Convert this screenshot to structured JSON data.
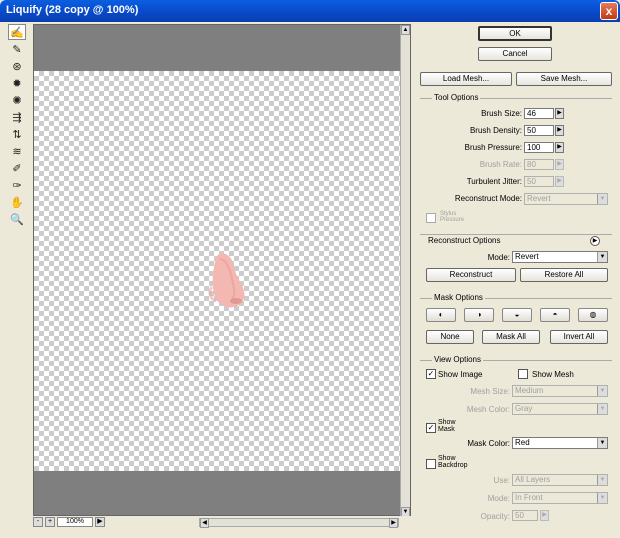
{
  "window": {
    "title": "Liquify (28 copy @ 100%)",
    "close_glyph": "x"
  },
  "tools": [
    {
      "name": "forward-warp-tool-icon",
      "glyph": "✍"
    },
    {
      "name": "reconstruct-tool-icon",
      "glyph": "✎"
    },
    {
      "name": "twirl-clockwise-tool-icon",
      "glyph": "⊛"
    },
    {
      "name": "pucker-tool-icon",
      "glyph": "✹"
    },
    {
      "name": "bloat-tool-icon",
      "glyph": "✺"
    },
    {
      "name": "push-left-tool-icon",
      "glyph": "⇶"
    },
    {
      "name": "mirror-tool-icon",
      "glyph": "⇅"
    },
    {
      "name": "turbulence-tool-icon",
      "glyph": "≋"
    },
    {
      "name": "freeze-mask-tool-icon",
      "glyph": "✐"
    },
    {
      "name": "thaw-mask-tool-icon",
      "glyph": "✑"
    },
    {
      "name": "hand-tool-icon",
      "glyph": "✋"
    },
    {
      "name": "zoom-tool-icon",
      "glyph": "🔍"
    }
  ],
  "statusbar": {
    "zoom": "100%",
    "minus": "-",
    "plus": "+"
  },
  "buttons": {
    "ok": "OK",
    "cancel": "Cancel",
    "load_mesh": "Load Mesh...",
    "save_mesh": "Save Mesh..."
  },
  "tool_options": {
    "title": "Tool Options",
    "brush_size_label": "Brush Size:",
    "brush_size": "46",
    "brush_density_label": "Brush Density:",
    "brush_density": "50",
    "brush_pressure_label": "Brush Pressure:",
    "brush_pressure": "100",
    "brush_rate_label": "Brush Rate:",
    "brush_rate": "80",
    "turbulent_jitter_label": "Turbulent Jitter:",
    "turbulent_jitter": "50",
    "reconstruct_mode_label": "Reconstruct Mode:",
    "reconstruct_mode": "Revert",
    "stylus_pressure_label": "Stylus Pressure"
  },
  "reconstruct_options": {
    "title": "Reconstruct Options",
    "mode_label": "Mode:",
    "mode": "Revert",
    "reconstruct_button": "Reconstruct",
    "restore_all_button": "Restore All"
  },
  "mask_options": {
    "title": "Mask Options",
    "none_button": "None",
    "mask_all_button": "Mask All",
    "invert_all_button": "Invert All"
  },
  "view_options": {
    "title": "View Options",
    "show_image_label": "Show Image",
    "show_mesh_label": "Show Mesh",
    "mesh_size_label": "Mesh Size:",
    "mesh_size": "Medium",
    "mesh_color_label": "Mesh Color:",
    "mesh_color": "Gray",
    "show_mask_label": "Show Mask",
    "mask_color_label": "Mask Color:",
    "mask_color": "Red",
    "show_backdrop_label": "Show Backdrop",
    "use_label": "Use:",
    "use": "All Layers",
    "mode_label": "Mode:",
    "mode": "In Front",
    "opacity_label": "Opacity:",
    "opacity": "50"
  },
  "glyphs": {
    "check": "✓",
    "down": "▼",
    "up": "▲",
    "left": "◀",
    "right": "▶",
    "play": "▶"
  }
}
